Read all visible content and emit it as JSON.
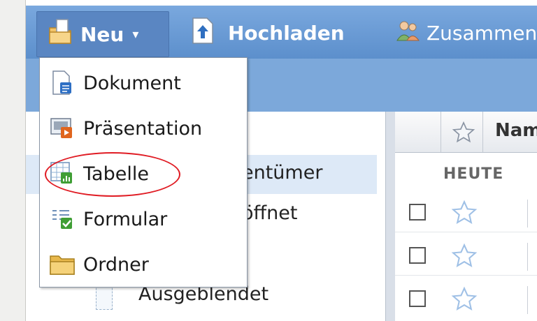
{
  "toolbar": {
    "new_label": "Neu",
    "new_caret": "▾",
    "upload_label": "Hochladen",
    "share_label": "Zusammen"
  },
  "new_menu": {
    "items": [
      {
        "label": "Dokument",
        "icon": "document-icon"
      },
      {
        "label": "Präsentation",
        "icon": "presentation-icon"
      },
      {
        "label": "Tabelle",
        "icon": "spreadsheet-icon",
        "highlighted": true
      },
      {
        "label": "Formular",
        "icon": "form-icon"
      },
      {
        "label": "Ordner",
        "icon": "folder-icon"
      }
    ]
  },
  "nav": {
    "items": [
      {
        "label_partial": "entümer",
        "selected": true
      },
      {
        "label_partial": "öffnet"
      },
      {
        "label": "Ausgeblendet"
      }
    ]
  },
  "list": {
    "header_name": "Nam",
    "group_today": "HEUTE"
  },
  "colors": {
    "toolbar_blue": "#6b9dd6",
    "highlight_ring": "#e01c24",
    "selection": "#dde9f7"
  }
}
